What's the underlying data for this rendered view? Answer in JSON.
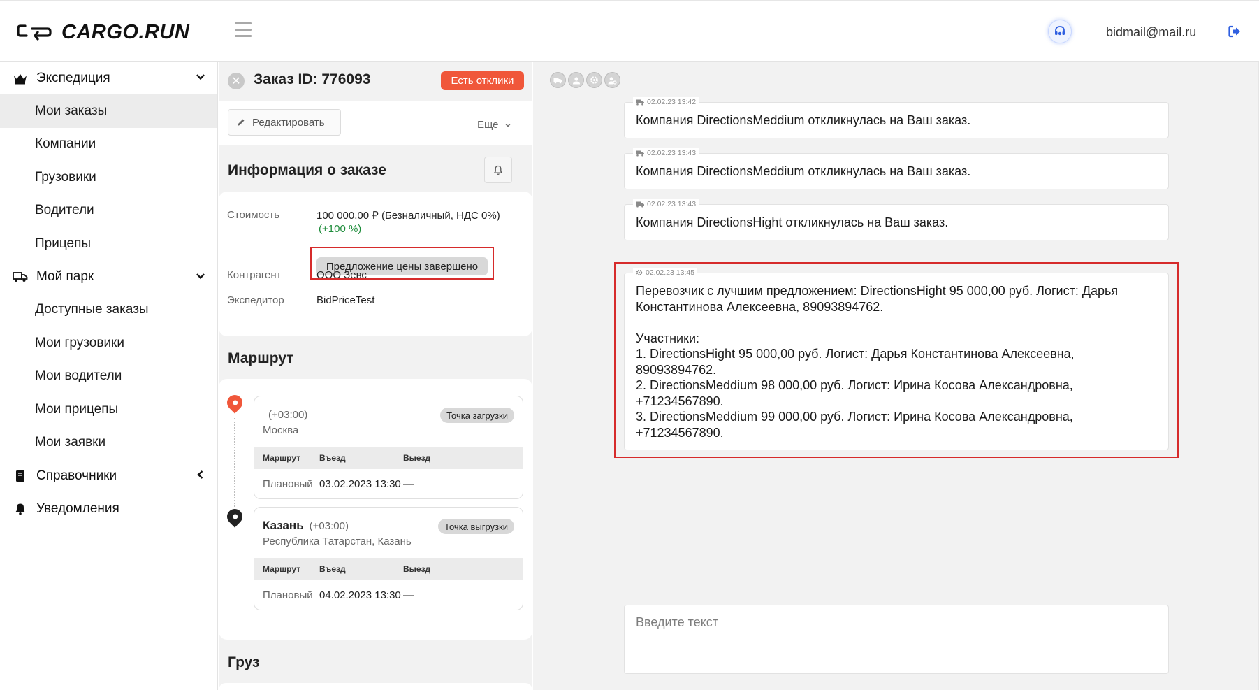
{
  "header": {
    "logo_text": "CARGO.RUN",
    "user_email": "bidmail@mail.ru"
  },
  "sidebar": {
    "sections": [
      {
        "label": "Экспедиция",
        "icon": "crown-icon",
        "expanded": true,
        "items": [
          "Мои заказы",
          "Компании",
          "Грузовики",
          "Водители",
          "Прицепы"
        ]
      },
      {
        "label": "Мой парк",
        "icon": "truck-icon",
        "expanded": true,
        "items": [
          "Доступные заказы",
          "Мои грузовики",
          "Мои водители",
          "Мои прицепы",
          "Мои заявки"
        ]
      },
      {
        "label": "Справочники",
        "icon": "book-icon",
        "expanded": false,
        "items": []
      },
      {
        "label": "Уведомления",
        "icon": "bell-icon",
        "items": []
      }
    ],
    "active_item": "Мои заказы"
  },
  "order": {
    "title": "Заказ ID: 776093",
    "responses_badge": "Есть отклики",
    "edit_label": "Редактировать",
    "more_label": "Еще",
    "info_title": "Информация о заказе",
    "fields": {
      "cost_label": "Стоимость",
      "cost_value": "100 000,00 ₽ (Безналичный, НДС 0%)",
      "cost_change": "(+100 %)",
      "price_status": "Предложение цены завершено",
      "counterparty_label": "Контрагент",
      "counterparty_value": "ООО Зевс",
      "forwarder_label": "Экспедитор",
      "forwarder_value": "BidPriceTest"
    },
    "route_title": "Маршрут",
    "route_columns": [
      "Маршрут",
      "Въезд",
      "Выезд"
    ],
    "points": [
      {
        "city": "",
        "tz": "(+03:00)",
        "address": "Москва",
        "type": "Точка загрузки",
        "row": {
          "route": "Плановый",
          "arrival": "03.02.2023 13:30",
          "departure": "—"
        }
      },
      {
        "city": "Казань",
        "tz": "(+03:00)",
        "address": "Республика Татарстан, Казань",
        "type": "Точка выгрузки",
        "row": {
          "route": "Плановый",
          "arrival": "04.02.2023 13:30",
          "departure": "—"
        }
      }
    ],
    "cargo_title": "Груз"
  },
  "chat": {
    "messages": [
      {
        "time": "02.02.23 13:42",
        "icon": "truck-icon",
        "text": "Компания DirectionsMeddium откликнулась на Ваш заказ."
      },
      {
        "time": "02.02.23 13:43",
        "icon": "truck-icon",
        "text": "Компания DirectionsMeddium откликнулась на Ваш заказ."
      },
      {
        "time": "02.02.23 13:43",
        "icon": "truck-icon",
        "text": "Компания DirectionsHight откликнулась на Ваш заказ."
      },
      {
        "time": "02.02.23 13:45",
        "icon": "gear-icon",
        "text": "Перевозчик с лучшим предложением: DirectionsHight 95 000,00 руб. Логист: Дарья Константинова Алексеевна, 89093894762.\n\nУчастники:\n1. DirectionsHight 95 000,00 руб. Логист: Дарья Константинова Алексеевна, 89093894762.\n2. DirectionsMeddium 98 000,00 руб. Логист: Ирина Косова Александровна, +71234567890.\n3. DirectionsMeddium 99 000,00 руб. Логист: Ирина Косова Александровна, +71234567890."
      }
    ],
    "input_placeholder": "Введите текст"
  },
  "colors": {
    "accent_badge": "#f0573a",
    "highlight_border": "#d62b2b",
    "positive": "#1d8c3a",
    "origin_pin": "#f0573a",
    "destination_pin": "#222222"
  }
}
